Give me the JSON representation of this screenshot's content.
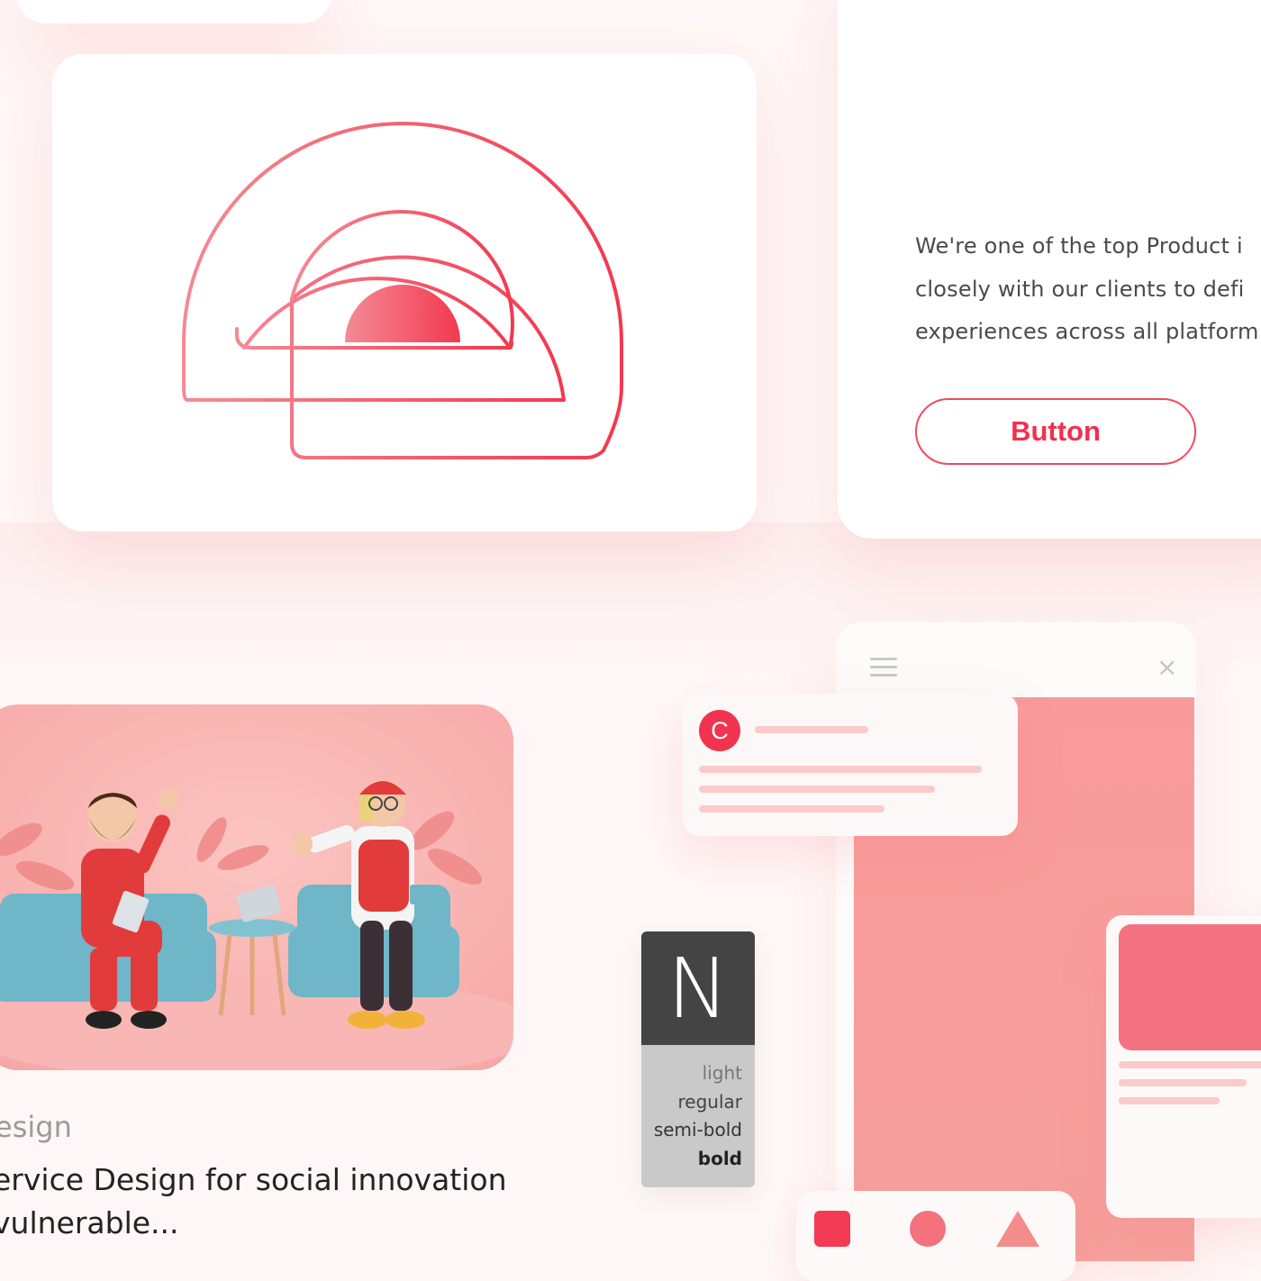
{
  "text_card": {
    "lines": [
      "We're one of the top Product i",
      "closely with our clients to defi",
      "experiences across all platform"
    ],
    "button_label": "Button"
  },
  "case_study": {
    "category": "esign",
    "title": "ervice Design for social innovation\n vulnerable..."
  },
  "notification": {
    "avatar_letter": "C"
  },
  "window_chrome": {
    "close_glyph": "×"
  },
  "typography_specimen": {
    "glyph": "N",
    "weights": [
      "light",
      "regular",
      "semi-bold",
      "bold"
    ]
  },
  "colors": {
    "accent": "#f0304f",
    "logo_gradient_start": "#f48a95",
    "logo_gradient_end": "#f2394f",
    "pink_panel": "#f99b9b",
    "line_placeholder": "#fbcaca"
  },
  "icons": {
    "logo": "concentric-arch-logo-icon",
    "menu": "hamburger-menu-icon",
    "close": "close-icon",
    "shapes": [
      "square-shape-icon",
      "circle-shape-icon",
      "triangle-shape-icon"
    ]
  }
}
